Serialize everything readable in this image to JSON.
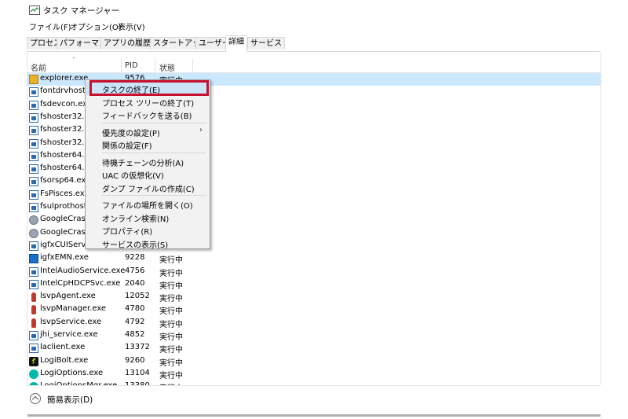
{
  "window": {
    "title": "タスク マネージャー"
  },
  "menu": [
    "ファイル(F)",
    "オプション(O)",
    "表示(V)"
  ],
  "tabs": [
    "プロセス",
    "パフォーマンス",
    "アプリの履歴",
    "スタートアップ",
    "ユーザー",
    "詳細",
    "サービス"
  ],
  "active_tab": "詳細",
  "columns": {
    "name": "名前",
    "pid": "PID",
    "status": "状態"
  },
  "rows": [
    {
      "name": "explorer.exe",
      "pid": "9576",
      "status": "実行中",
      "icon": "folder-icon"
    },
    {
      "name": "fontdrvhost",
      "pid": "",
      "status": "",
      "icon": "window-icon"
    },
    {
      "name": "fsdevcon.exe",
      "pid": "",
      "status": "",
      "icon": "window-icon"
    },
    {
      "name": "fshoster32.ex",
      "pid": "",
      "status": "",
      "icon": "window-icon"
    },
    {
      "name": "fshoster32.ex",
      "pid": "",
      "status": "",
      "icon": "window-icon"
    },
    {
      "name": "fshoster32.ex",
      "pid": "",
      "status": "",
      "icon": "window-icon"
    },
    {
      "name": "fshoster64.ex",
      "pid": "",
      "status": "",
      "icon": "window-icon"
    },
    {
      "name": "fshoster64.ex",
      "pid": "",
      "status": "",
      "icon": "window-icon"
    },
    {
      "name": "fsorsp64.exe",
      "pid": "",
      "status": "",
      "icon": "window-icon"
    },
    {
      "name": "FsPisces.exe",
      "pid": "",
      "status": "",
      "icon": "window-icon"
    },
    {
      "name": "fsulprothoste",
      "pid": "",
      "status": "",
      "icon": "window-icon"
    },
    {
      "name": "GoogleCrash",
      "pid": "",
      "status": "",
      "icon": "gear-icon"
    },
    {
      "name": "GoogleCrash",
      "pid": "",
      "status": "",
      "icon": "gear-icon"
    },
    {
      "name": "igfxCUIServic",
      "pid": "",
      "status": "",
      "icon": "window-icon"
    },
    {
      "name": "igfxEMN.exe",
      "pid": "9228",
      "status": "実行中",
      "icon": "intel-icon"
    },
    {
      "name": "IntelAudioService.exe",
      "pid": "4756",
      "status": "実行中",
      "icon": "window-icon"
    },
    {
      "name": "IntelCpHDCPSvc.exe",
      "pid": "2040",
      "status": "実行中",
      "icon": "window-icon"
    },
    {
      "name": "lsvpAgent.exe",
      "pid": "12052",
      "status": "実行中",
      "icon": "lsvp-icon"
    },
    {
      "name": "lsvpManager.exe",
      "pid": "4780",
      "status": "実行中",
      "icon": "lsvp-icon"
    },
    {
      "name": "lsvpService.exe",
      "pid": "4792",
      "status": "実行中",
      "icon": "lsvp-icon"
    },
    {
      "name": "jhi_service.exe",
      "pid": "4852",
      "status": "実行中",
      "icon": "window-icon"
    },
    {
      "name": "laclient.exe",
      "pid": "13372",
      "status": "実行中",
      "icon": "window-icon"
    },
    {
      "name": "LogiBolt.exe",
      "pid": "9260",
      "status": "実行中",
      "icon": "logibolt-icon"
    },
    {
      "name": "LogiOptions.exe",
      "pid": "13104",
      "status": "実行中",
      "icon": "logi-icon"
    },
    {
      "name": "LogiOptionsMgr.exe",
      "pid": "13380",
      "status": "実行中",
      "icon": "logi-icon"
    }
  ],
  "context_menu": [
    {
      "label": "タスクの終了(E)",
      "highlighted": true
    },
    {
      "label": "プロセス ツリーの終了(T)"
    },
    {
      "label": "フィードバックを送る(B)"
    },
    {
      "separator": true
    },
    {
      "label": "優先度の設定(P)",
      "submenu": true
    },
    {
      "label": "関係の設定(F)"
    },
    {
      "separator": true
    },
    {
      "label": "待機チェーンの分析(A)"
    },
    {
      "label": "UAC の仮想化(V)"
    },
    {
      "label": "ダンプ ファイルの作成(C)"
    },
    {
      "separator": true
    },
    {
      "label": "ファイルの場所を開く(O)"
    },
    {
      "label": "オンライン検索(N)"
    },
    {
      "label": "プロパティ(R)"
    },
    {
      "label": "サービスの表示(S)"
    }
  ],
  "footer": {
    "fewer_details": "簡易表示(D)"
  },
  "colors": {
    "selection": "#cce8ff",
    "highlight_box": "#c8102e"
  }
}
